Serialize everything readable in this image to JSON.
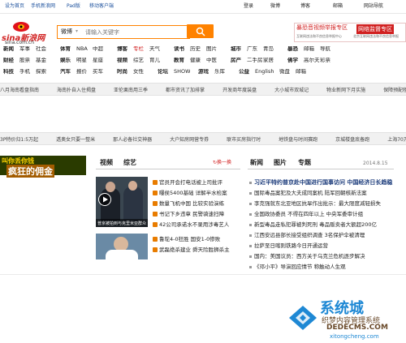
{
  "topnav": {
    "left": [
      "设为首页",
      "手机新浪网",
      "Pad版",
      "移动客户端"
    ],
    "right": [
      "登录",
      "微博",
      "博客",
      "邮箱",
      "网站导航"
    ]
  },
  "logo": {
    "text": "sina新浪网",
    "domain": "sina.com.cn"
  },
  "search": {
    "scope": "微博",
    "placeholder": "请输入关键字"
  },
  "report": {
    "line1": "暴恐音视频举报专区",
    "line2": "网络监督专区",
    "sub1": "互联网违法和不良信息举报中心",
    "sub2": "北京互联网违法和不良信息举报"
  },
  "nav_rows": [
    [
      "新闻",
      "军事",
      "社会",
      "体育",
      "NBA",
      "中超",
      "博客",
      "专栏",
      "天气",
      "读书",
      "历史",
      "图片",
      "城市",
      "广东",
      "青岛",
      "暴恐",
      "邮箱",
      "导航"
    ],
    [
      "财经",
      "股票",
      "基金",
      "娱乐",
      "明星",
      "星座",
      "视频",
      "综艺",
      "育儿",
      "教育",
      "健康",
      "中医",
      "房产",
      "二手房",
      "家居",
      "佛学",
      "高尔夫",
      "彩票"
    ],
    [
      "科技",
      "手机",
      "探索",
      "汽车",
      "报价",
      "买车",
      "时尚",
      "女性",
      "论坛",
      "SHOW",
      "游戏",
      "乐库",
      "公益",
      "English",
      "微盘",
      "邮箱"
    ]
  ],
  "strip1": [
    "八月海南看盘指南",
    "海南扑自入住揭盘",
    "亚伦栗南用三季",
    "都市资讯了加排掌",
    "开发商年度装盘",
    "大小城市双城记",
    "物业新网下月实施",
    "保障预配租成功"
  ],
  "strip2": [
    "3P特价归1:5万起",
    "透奥女只要一整米",
    "那人必备社交神器",
    "大户知房网营专券",
    "联市买房指行时",
    "地铁盘与时间赛跑",
    "京城楼盘底备跑",
    "上海70万抢扬房"
  ],
  "ad": {
    "line1": "叫你丢你钱",
    "line2": "疯狂的佣金"
  },
  "video_tabs": {
    "t1": "视频",
    "t2": "综艺",
    "action": "换一换"
  },
  "video_caption": "普京被拍到与克里米亚群众",
  "video_items": [
    "官员开会打电话被上司批评",
    "曝侯5400基础 详解半水检案",
    "数量飞机中国 比较实验演练",
    "书记下乡违章 民警骑速扫障",
    "42公司承诺水不录用涉毒艺人"
  ],
  "video_items2": [
    "鲁鸵4-0狂胜 国安1-0惨败",
    "武磊绝杀建业 舜天险胜狮杀主"
  ],
  "news_tabs": {
    "t1": "新闻",
    "t2": "图片",
    "t3": "专题",
    "date": "2014.8.15"
  },
  "news_items": [
    "习近平特约普京赴中国进行国事访问 中国经济日长趋稳",
    "国际毒品案犯及大夫成同案机 陆军回朝核新法案",
    "李克强就东北亚地区抗旱作出批示：最大限度减轻损失",
    "全国政协委员 不得在四年以上 中央军委审计组",
    "新型毒品走私犯罪被判死刑 毒品贩卖者大额超200亿",
    "江西安远县部长接受组织调查 3名保护伞被清理",
    "拉萨至日喀则铁路今日开通运营",
    "国内：美国议员：西方关于乌克兰危机逐步解决",
    "《邓小平》导演回应情节 称触动人生观"
  ],
  "watermark": {
    "main": "系统城",
    "sub1": "织梦内容管理系统",
    "sub2": "DEDECMS.COM",
    "sub3": "xitongcheng.com"
  },
  "colors": {
    "accent": "#ff8200",
    "link": "#1a4f9c",
    "red": "#d12020"
  }
}
